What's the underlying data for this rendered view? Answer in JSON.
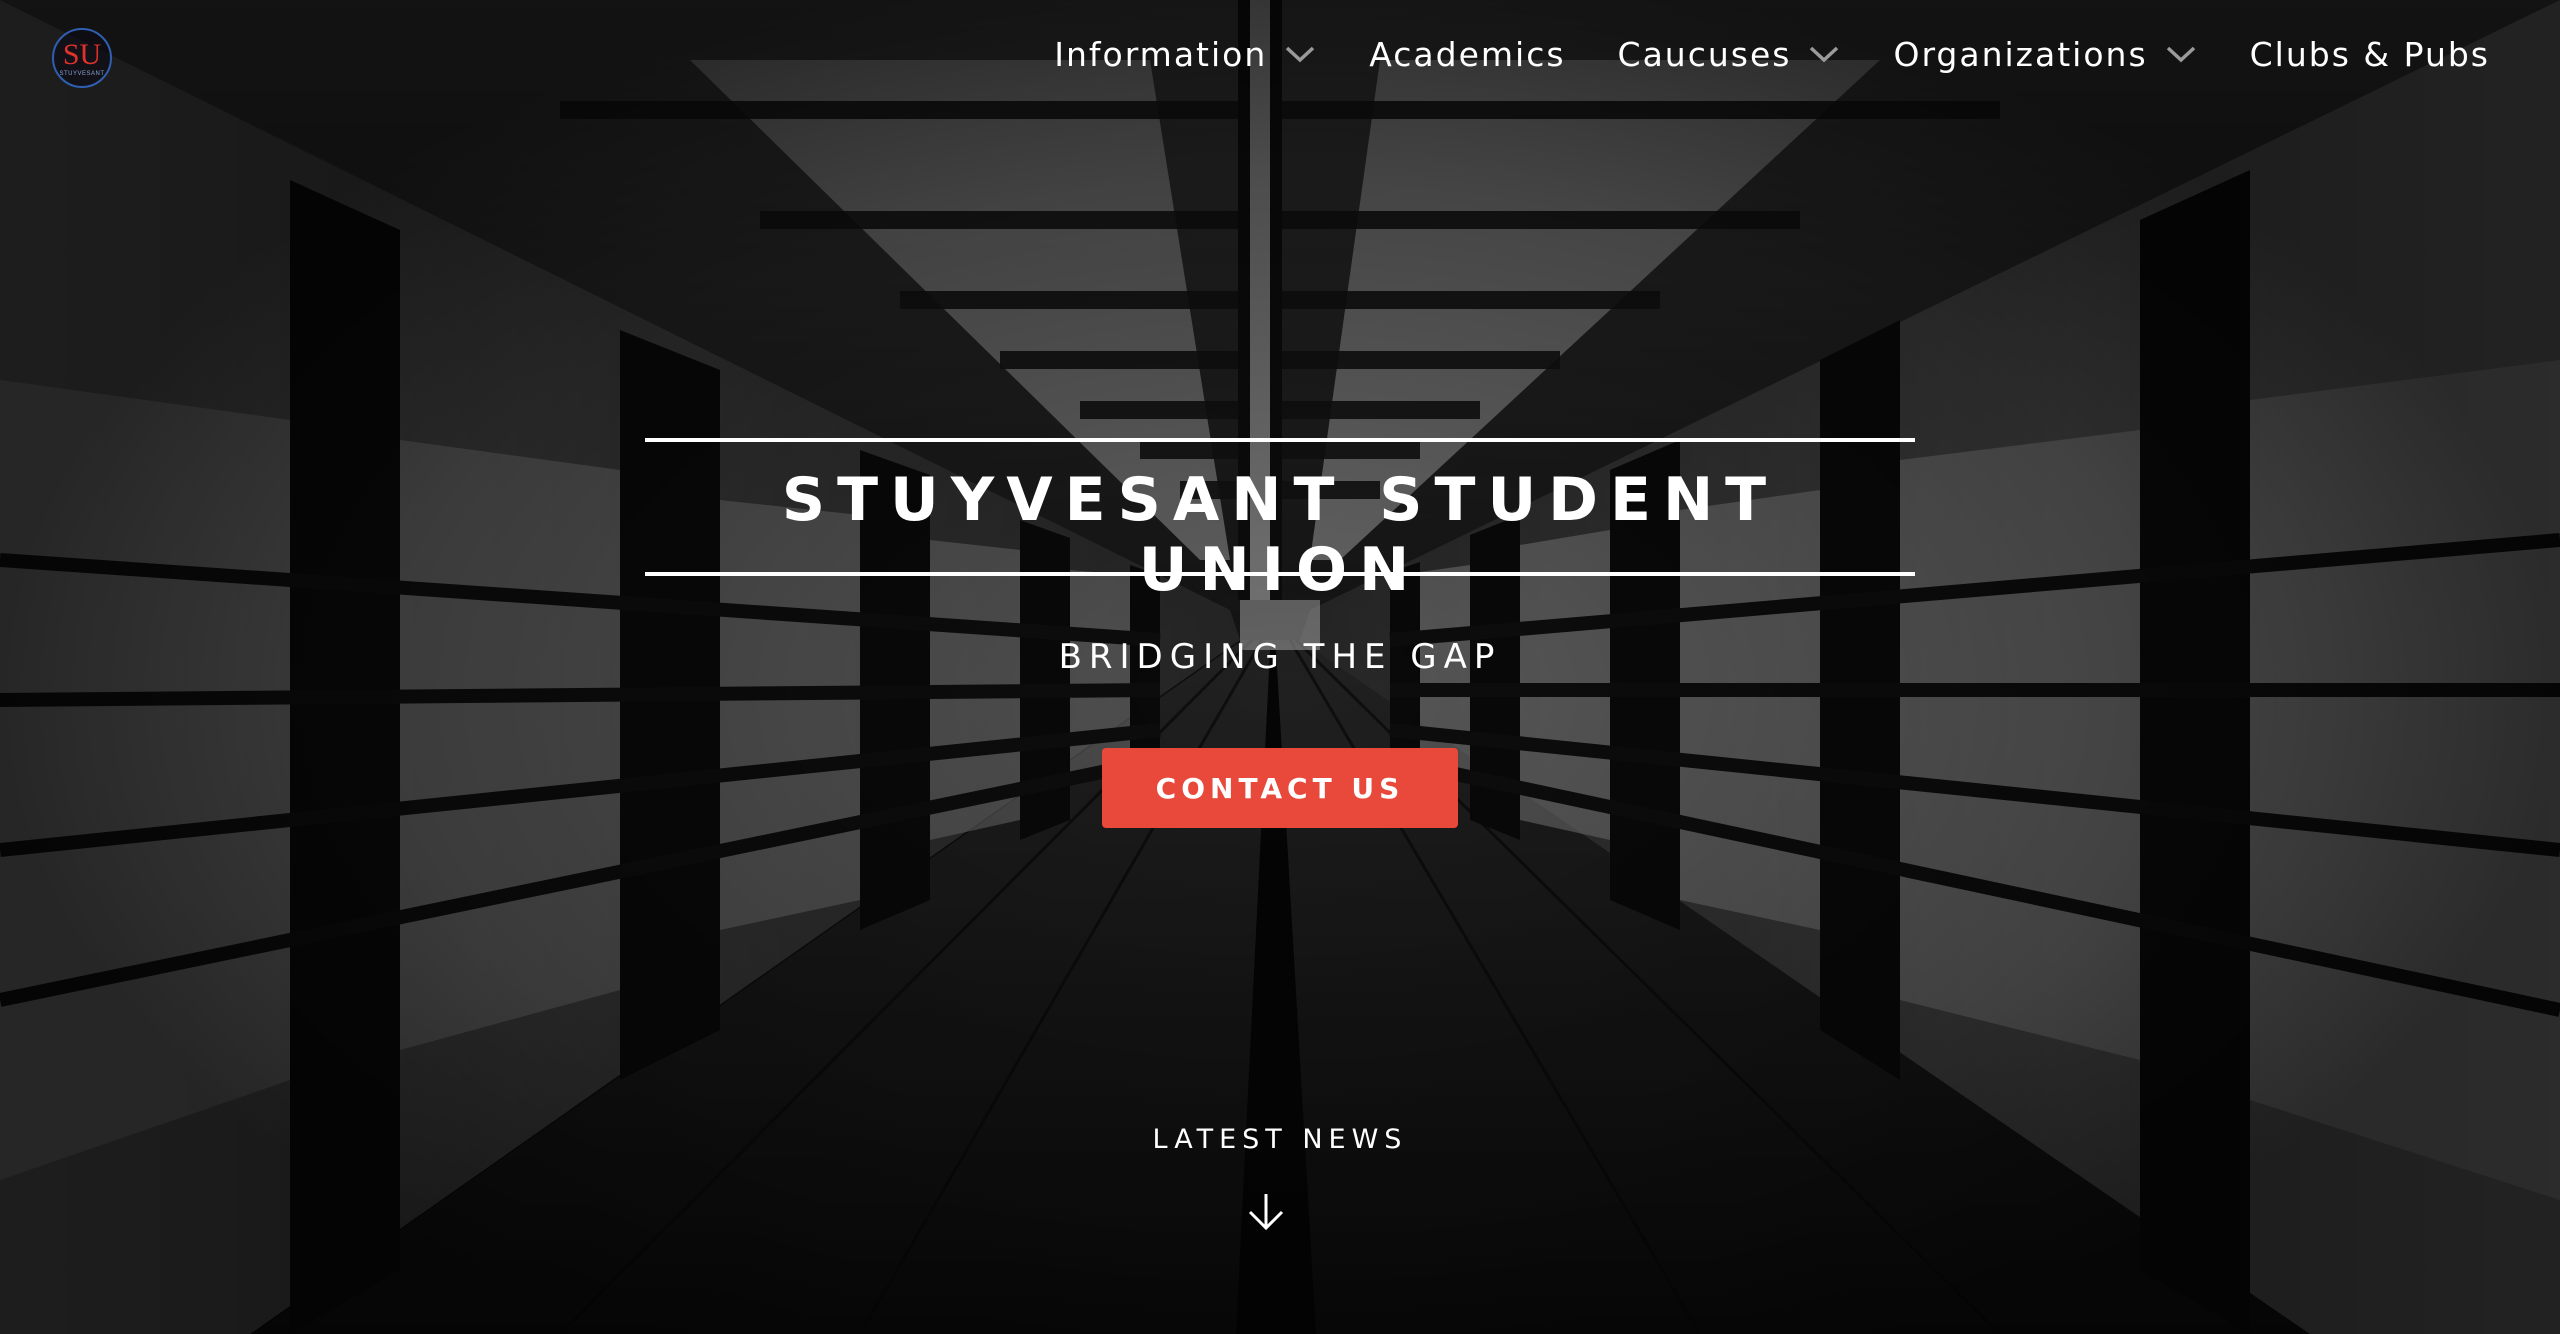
{
  "logo": {
    "mark": "SU",
    "subtext": "STUYVESANT"
  },
  "nav": {
    "items": [
      {
        "label": "Information",
        "has_dropdown": true
      },
      {
        "label": "Academics",
        "has_dropdown": false
      },
      {
        "label": "Caucuses",
        "has_dropdown": true
      },
      {
        "label": "Organizations",
        "has_dropdown": true
      },
      {
        "label": "Clubs & Pubs",
        "has_dropdown": false
      }
    ]
  },
  "hero": {
    "title": "STUYVESANT STUDENT UNION",
    "subtitle": "BRIDGING THE GAP",
    "cta_label": "CONTACT US",
    "news_label": "LATEST NEWS",
    "scroll_icon": "arrow-down-icon"
  },
  "colors": {
    "accent": "#e8493b",
    "text": "#ffffff",
    "logo_red": "#e0322b",
    "logo_blue": "#2f5fb0"
  }
}
